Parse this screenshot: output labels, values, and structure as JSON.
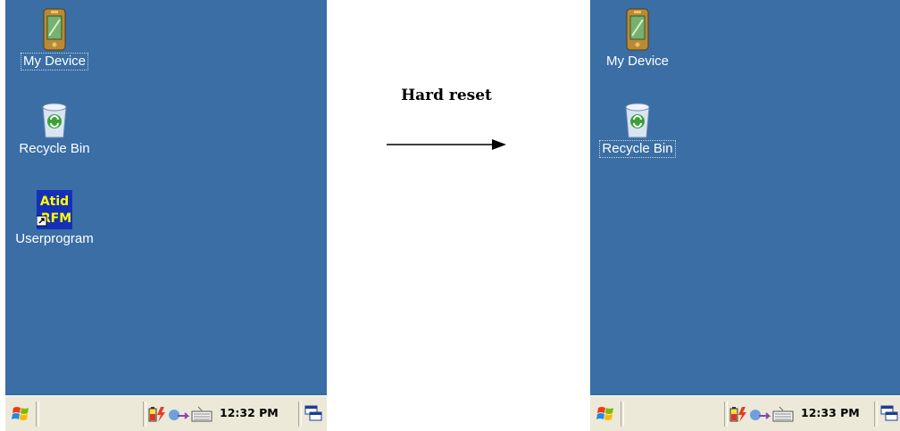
{
  "caption": "Hard reset",
  "before": {
    "icons": [
      {
        "label": "My Device",
        "icon": "pda-icon",
        "selected": true
      },
      {
        "label": "Recycle Bin",
        "icon": "recycle-bin-icon",
        "selected": false
      },
      {
        "label": "Userprogram",
        "icon": "atid-rfm-shortcut-icon",
        "selected": false,
        "icon_text": [
          "Atid",
          "RFM"
        ]
      }
    ],
    "clock": "12:32 PM"
  },
  "after": {
    "icons": [
      {
        "label": "My Device",
        "icon": "pda-icon",
        "selected": false
      },
      {
        "label": "Recycle Bin",
        "icon": "recycle-bin-icon",
        "selected": true
      }
    ],
    "clock": "12:33 PM"
  },
  "colors": {
    "desktop": "#3a6ea5",
    "taskbar": "#ece9d8"
  }
}
